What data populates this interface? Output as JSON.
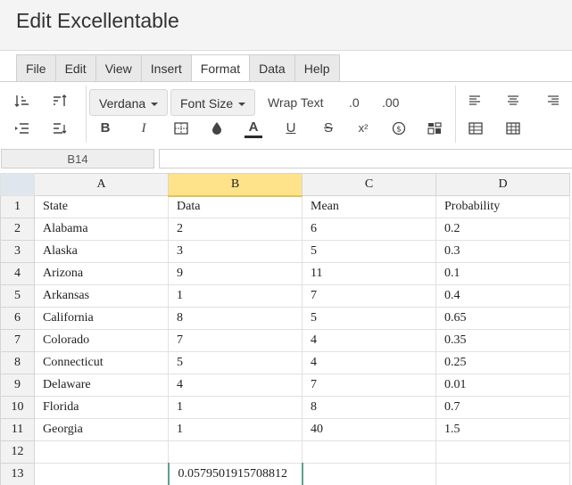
{
  "app": {
    "title": "Edit Excellentable"
  },
  "menu": {
    "tabs": [
      {
        "label": "File"
      },
      {
        "label": "Edit"
      },
      {
        "label": "View"
      },
      {
        "label": "Insert"
      },
      {
        "label": "Format",
        "active": true
      },
      {
        "label": "Data"
      },
      {
        "label": "Help"
      }
    ]
  },
  "toolbar": {
    "font_family": "Verdana",
    "font_size": "Font Size",
    "wrap_text": "Wrap Text",
    "decimal_decrease": ".0",
    "decimal_increase": ".00",
    "bold": "B",
    "italic": "I",
    "underline": "U",
    "strike": "S",
    "superscript": "x²",
    "font_color": "A",
    "font_color_value": "#2b2b2b",
    "icons": [
      "sort-ascending-icon",
      "sort-descending-icon",
      "indent-increase-icon",
      "indent-decrease-icon",
      "borders-icon",
      "fill-color-icon",
      "currency-icon",
      "conditional-format-icon",
      "align-left-icon",
      "align-center-icon",
      "align-right-icon",
      "table-icon",
      "grid-icon"
    ]
  },
  "formula_bar": {
    "cell_ref": "B14",
    "value": ""
  },
  "grid": {
    "columns": [
      "A",
      "B",
      "C",
      "D"
    ],
    "selected_column": "B",
    "rows": [
      {
        "num": "1",
        "cells": [
          "State",
          "Data",
          "Mean",
          "Probability"
        ]
      },
      {
        "num": "2",
        "cells": [
          "Alabama",
          "2",
          "6",
          "0.2"
        ]
      },
      {
        "num": "3",
        "cells": [
          "Alaska",
          "3",
          "5",
          "0.3"
        ]
      },
      {
        "num": "4",
        "cells": [
          "Arizona",
          "9",
          "11",
          "0.1"
        ]
      },
      {
        "num": "5",
        "cells": [
          "Arkansas",
          "1",
          "7",
          "0.4"
        ]
      },
      {
        "num": "6",
        "cells": [
          "California",
          "8",
          "5",
          "0.65"
        ]
      },
      {
        "num": "7",
        "cells": [
          "Colorado",
          "7",
          "4",
          "0.35"
        ]
      },
      {
        "num": "8",
        "cells": [
          "Connecticut",
          "5",
          "4",
          "0.25"
        ]
      },
      {
        "num": "9",
        "cells": [
          "Delaware",
          "4",
          "7",
          "0.01"
        ]
      },
      {
        "num": "10",
        "cells": [
          "Florida",
          "1",
          "8",
          "0.7"
        ]
      },
      {
        "num": "11",
        "cells": [
          "Georgia",
          "1",
          "40",
          "1.5"
        ]
      },
      {
        "num": "12",
        "cells": [
          "",
          "",
          "",
          ""
        ]
      },
      {
        "num": "13",
        "cells": [
          "",
          "0.0579501915708812",
          "",
          ""
        ]
      }
    ]
  }
}
